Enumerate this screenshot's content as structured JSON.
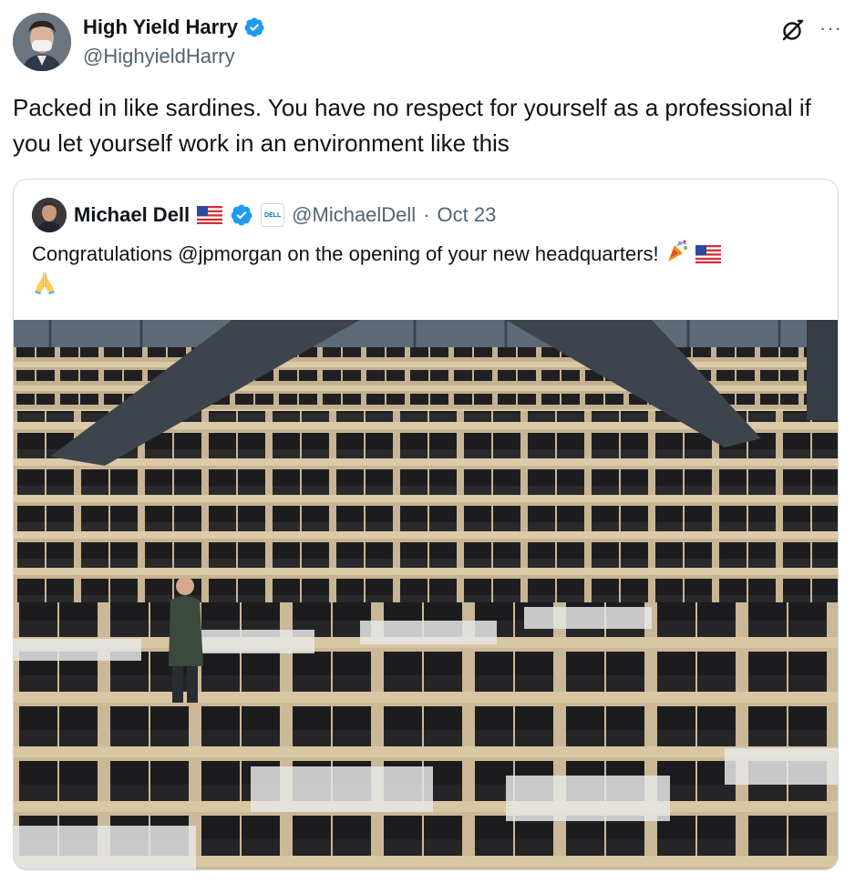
{
  "author": {
    "display_name": "High Yield Harry",
    "handle": "@HighyieldHarry",
    "verified_icon": "verified-badge-icon"
  },
  "actions": {
    "grok_icon": "grok-icon",
    "more_label": "···"
  },
  "tweet": {
    "text": "Packed in like sardines. You have no respect for yourself as a professional if you let yourself work in an environment like this"
  },
  "quoted": {
    "display_name": "Michael Dell",
    "handle": "@MichaelDell",
    "separator": "·",
    "date": "Oct 23",
    "text": "Congratulations @jpmorgan on the opening of your new headquarters!",
    "affiliate_badge": "DELL Technologies",
    "emojis": [
      "party-popper",
      "us-flag",
      "folded-hands"
    ],
    "image_alt": "trading floor with rows of desks and monitors"
  },
  "colors": {
    "text_primary": "#0f1419",
    "text_secondary": "#536471",
    "verified_blue": "#1d9bf0",
    "border": "#cfd9de"
  }
}
